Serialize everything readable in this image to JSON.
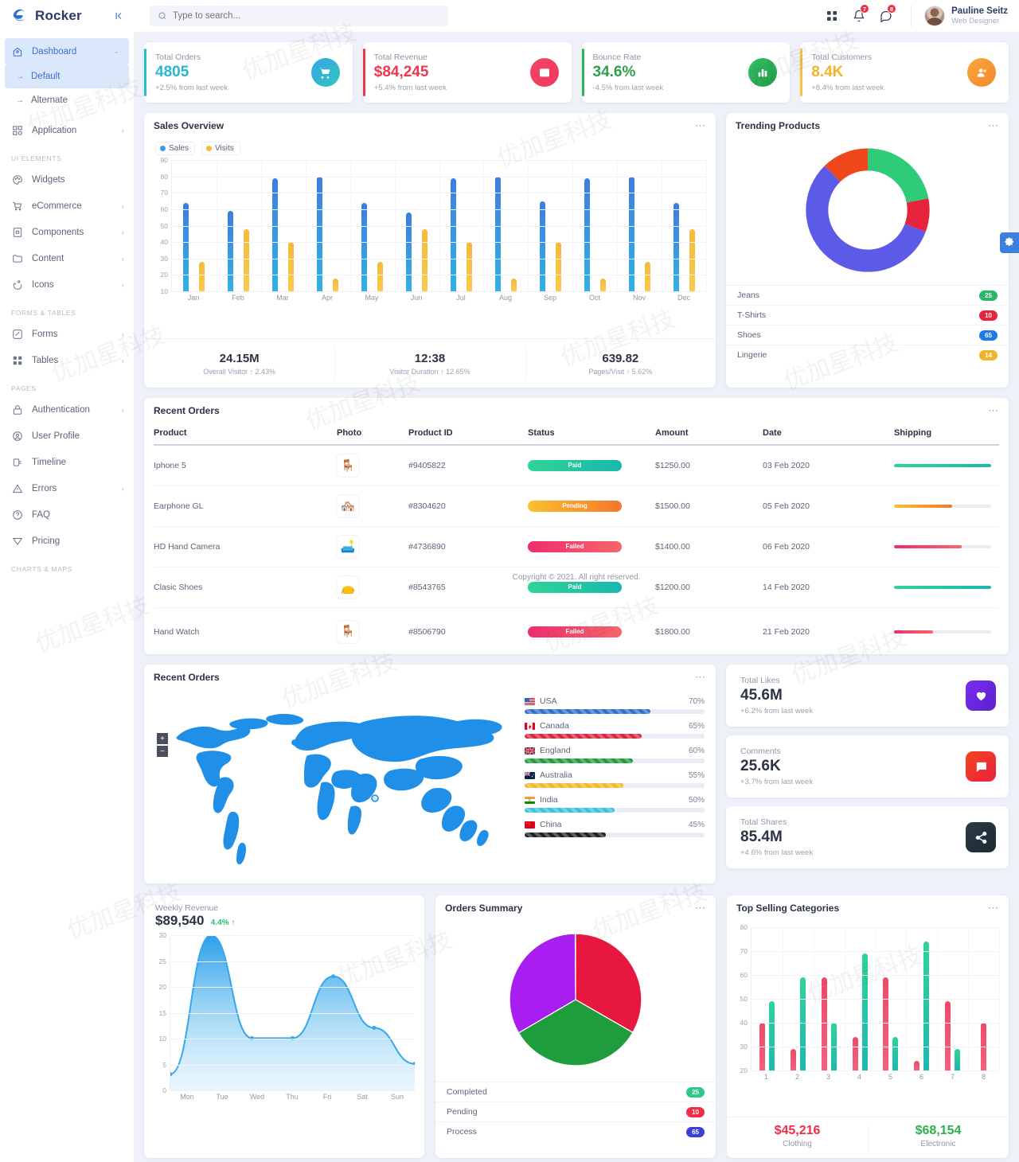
{
  "brand": {
    "name": "Rocker",
    "logo_icon": "wave-logo-icon",
    "collapse_icon": "collapse-left-icon"
  },
  "search": {
    "placeholder": "Type to search...",
    "value": "",
    "icon": "search-icon"
  },
  "header": {
    "grid_icon": "grid-apps-icon",
    "bell_icon": "bell-icon",
    "bell_badge": "7",
    "message_icon": "message-icon",
    "message_badge": "8",
    "user_name": "Pauline Seitz",
    "user_role": "Web Designer"
  },
  "sidebar": {
    "items": [
      {
        "label": "Dashboard",
        "icon": "home-icon",
        "chevron": "⌄",
        "active": true
      },
      {
        "label": "Default",
        "sub": true,
        "active": true
      },
      {
        "label": "Alternate",
        "sub": true,
        "active": false
      },
      {
        "label": "Application",
        "icon": "apps-grid-icon",
        "chevron": "‹"
      }
    ],
    "sections": [
      {
        "title": "UI ELEMENTS",
        "items": [
          {
            "label": "Widgets",
            "icon": "palette-icon",
            "chevron": ""
          },
          {
            "label": "eCommerce",
            "icon": "cart-icon",
            "chevron": "‹"
          },
          {
            "label": "Components",
            "icon": "component-icon",
            "chevron": "‹"
          },
          {
            "label": "Content",
            "icon": "folder-icon",
            "chevron": "‹"
          },
          {
            "label": "Icons",
            "icon": "hand-icon",
            "chevron": "‹"
          }
        ]
      },
      {
        "title": "FORMS & TABLES",
        "items": [
          {
            "label": "Forms",
            "icon": "edit-icon",
            "chevron": "‹"
          },
          {
            "label": "Tables",
            "icon": "table-icon",
            "chevron": "‹"
          }
        ]
      },
      {
        "title": "PAGES",
        "items": [
          {
            "label": "Authentication",
            "icon": "lock-icon",
            "chevron": "‹"
          },
          {
            "label": "User Profile",
            "icon": "user-circle-icon",
            "chevron": ""
          },
          {
            "label": "Timeline",
            "icon": "timeline-icon",
            "chevron": ""
          },
          {
            "label": "Errors",
            "icon": "warning-icon",
            "chevron": "‹"
          },
          {
            "label": "FAQ",
            "icon": "question-icon",
            "chevron": ""
          },
          {
            "label": "Pricing",
            "icon": "tag-icon",
            "chevron": ""
          }
        ]
      },
      {
        "title": "CHARTS & MAPS",
        "items": []
      }
    ]
  },
  "stats": [
    {
      "label": "Total Orders",
      "value": "4805",
      "sub": "+2.5% from last week",
      "color": "#28b7d3",
      "accent": "#2bc0c8",
      "icon": "cart-icon",
      "icon_from": "#3aa3e8",
      "icon_to": "#2ec7c0"
    },
    {
      "label": "Total Revenue",
      "value": "$84,245",
      "sub": "+5.4% from last week",
      "color": "#f0374f",
      "accent": "#ef3550",
      "icon": "wallet-icon",
      "icon_from": "#f2456a",
      "icon_to": "#ef3a5c"
    },
    {
      "label": "Bounce Rate",
      "value": "34.6%",
      "sub": "-4.5% from last week",
      "color": "#2f9e4f",
      "accent": "#2eb35b",
      "icon": "bar-chart-icon",
      "icon_from": "#36c06a",
      "icon_to": "#229a46"
    },
    {
      "label": "Total Customers",
      "value": "8.4K",
      "sub": "+8.4% from last week",
      "color": "#f0b429",
      "accent": "#f5c33b",
      "icon": "users-icon",
      "icon_from": "#f8a93c",
      "icon_to": "#f2872c"
    }
  ],
  "sales_overview": {
    "title": "Sales Overview",
    "legend": [
      {
        "name": "Sales",
        "color": "#3f9ae5"
      },
      {
        "name": "Visits",
        "color": "#f6b93b"
      }
    ],
    "footer": [
      {
        "value": "24.15M",
        "sub": "Overall Visitor ↑ 2.43%"
      },
      {
        "value": "12:38",
        "sub": "Visitor Duration ↑ 12.65%"
      },
      {
        "value": "639.82",
        "sub": "Pages/Visit ↑ 5.62%"
      }
    ]
  },
  "trending": {
    "title": "Trending Products",
    "items": [
      {
        "label": "Jeans",
        "badge": "25",
        "color": "#28b866"
      },
      {
        "label": "T-Shirts",
        "badge": "10",
        "color": "#e8243d"
      },
      {
        "label": "Shoes",
        "badge": "65",
        "color": "#1f7ae8"
      },
      {
        "label": "Lingerie",
        "badge": "14",
        "color": "#f0b429"
      }
    ]
  },
  "recent_orders": {
    "title": "Recent Orders",
    "columns": [
      "Product",
      "Photo",
      "Product ID",
      "Status",
      "Amount",
      "Date",
      "Shipping"
    ],
    "rows": [
      {
        "product": "Iphone 5",
        "photo": "🪑",
        "id": "#9405822",
        "status": "Paid",
        "status_from": "#2fd495",
        "status_to": "#19b7b0",
        "amount": "$1250.00",
        "date": "03 Feb 2020",
        "ship": 100,
        "ship_from": "#2fd495",
        "ship_to": "#19b7b0"
      },
      {
        "product": "Earphone GL",
        "photo": "🏘️",
        "id": "#8304620",
        "status": "Pending",
        "status_from": "#fbc02d",
        "status_to": "#f4762b",
        "amount": "$1500.00",
        "date": "05 Feb 2020",
        "ship": 60,
        "ship_from": "#fbc02d",
        "ship_to": "#f4762b"
      },
      {
        "product": "HD Hand Camera",
        "photo": "🛋️",
        "id": "#4736890",
        "status": "Failed",
        "status_from": "#ef2c6e",
        "status_to": "#f7666a",
        "amount": "$1400.00",
        "date": "06 Feb 2020",
        "ship": 70,
        "ship_from": "#ef2c6e",
        "ship_to": "#f7666a"
      },
      {
        "product": "Clasic Shoes",
        "photo": "👝",
        "id": "#8543765",
        "status": "Paid",
        "status_from": "#2fd495",
        "status_to": "#19b7b0",
        "amount": "$1200.00",
        "date": "14 Feb 2020",
        "ship": 100,
        "ship_from": "#2fd495",
        "ship_to": "#19b7b0"
      },
      {
        "product": "Hand Watch",
        "photo": "🪑",
        "id": "#8506790",
        "status": "Failed",
        "status_from": "#ef2c6e",
        "status_to": "#f7666a",
        "amount": "$1800.00",
        "date": "21 Feb 2020",
        "ship": 40,
        "ship_from": "#ef2c6e",
        "ship_to": "#f7666a"
      }
    ],
    "copyright": "Copyright © 2021. All right reserved."
  },
  "map_panel": {
    "title": "Recent Orders",
    "zoom_in": "+",
    "zoom_out": "−",
    "countries": [
      {
        "name": "USA",
        "pct": "70%",
        "value": 70,
        "color": "#2f6fd0"
      },
      {
        "name": "Canada",
        "pct": "65%",
        "value": 65,
        "color": "#d6293e"
      },
      {
        "name": "England",
        "pct": "60%",
        "value": 60,
        "color": "#1f9c3b"
      },
      {
        "name": "Australia",
        "pct": "55%",
        "value": 55,
        "color": "#f0b82a"
      },
      {
        "name": "India",
        "pct": "50%",
        "value": 50,
        "color": "#35c3e0"
      },
      {
        "name": "China",
        "pct": "45%",
        "value": 45,
        "color": "#222222"
      }
    ]
  },
  "social": [
    {
      "label": "Total Likes",
      "value": "45.6M",
      "sub": "+6.2% from last week",
      "icon": "heart-icon",
      "from": "#7b2ff0",
      "to": "#5b1fd0"
    },
    {
      "label": "Comments",
      "value": "25.6K",
      "sub": "+3.7% from last week",
      "icon": "comment-icon",
      "from": "#f7451f",
      "to": "#e8203f"
    },
    {
      "label": "Total Shares",
      "value": "85.4M",
      "sub": "+4.6% from last week",
      "icon": "share-icon",
      "from": "#2a3b45",
      "to": "#1c2b33"
    }
  ],
  "weekly_revenue": {
    "title": "Weekly Revenue",
    "value": "$89,540",
    "delta": "4.4% ↑"
  },
  "orders_summary": {
    "title": "Orders Summary",
    "items": [
      {
        "label": "Completed",
        "badge": "25",
        "color": "#2bc98a"
      },
      {
        "label": "Pending",
        "badge": "10",
        "color": "#ef2d4a"
      },
      {
        "label": "Process",
        "badge": "65",
        "color": "#3b3fd8"
      }
    ]
  },
  "top_selling": {
    "title": "Top Selling Categories",
    "footer": [
      {
        "value": "$45,216",
        "name": "Clothing",
        "color": "#ef2d4a"
      },
      {
        "value": "$68,154",
        "name": "Electronic",
        "color": "#2bb24c"
      }
    ]
  },
  "fab": {
    "icon": "gear-icon"
  },
  "chart_data": [
    {
      "type": "bar",
      "title": "Sales Overview",
      "categories": [
        "Jan",
        "Feb",
        "Mar",
        "Apr",
        "May",
        "Jun",
        "Jul",
        "Aug",
        "Sep",
        "Oct",
        "Nov",
        "Dec"
      ],
      "series": [
        {
          "name": "Sales",
          "color": "#3f9ae5",
          "values": [
            64,
            59,
            79,
            80,
            64,
            58,
            79,
            80,
            65,
            79,
            80,
            64
          ]
        },
        {
          "name": "Visits",
          "color": "#f6b93b",
          "values": [
            28,
            48,
            40,
            18,
            28,
            48,
            40,
            18,
            40,
            18,
            28,
            48
          ]
        }
      ],
      "ylim": [
        10,
        90
      ],
      "yticks": [
        10,
        20,
        30,
        40,
        50,
        60,
        70,
        80,
        90
      ],
      "xlabel": "",
      "ylabel": "",
      "grid": true,
      "legend": "top-left"
    },
    {
      "type": "pie",
      "title": "Trending Products",
      "labels": [
        "Jeans",
        "T-Shirts",
        "Shoes",
        "Lingerie"
      ],
      "values": [
        25,
        10,
        65,
        14
      ],
      "colors": [
        "#2ecc78",
        "#e8243d",
        "#5b5be8",
        "#f0461b"
      ],
      "donut": true
    },
    {
      "type": "area",
      "title": "Weekly Revenue",
      "x": [
        "Mon",
        "Tue",
        "Wed",
        "Thu",
        "Fri",
        "Sat",
        "Sun"
      ],
      "values": [
        3,
        30,
        10,
        10,
        22,
        12,
        5
      ],
      "ylim": [
        0,
        30
      ],
      "yticks": [
        0,
        5,
        10,
        15,
        20,
        25,
        30
      ],
      "color": "#35a8ec",
      "grid": true
    },
    {
      "type": "pie",
      "title": "Orders Summary",
      "labels": [
        "Completed",
        "Pending",
        "Process"
      ],
      "values": [
        33.3,
        33.3,
        33.3
      ],
      "colors": [
        "#e8173f",
        "#1f9c3b",
        "#a81ef0"
      ],
      "donut": false
    },
    {
      "type": "bar",
      "title": "Top Selling Categories",
      "categories": [
        "1",
        "2",
        "3",
        "4",
        "5",
        "6",
        "7",
        "8"
      ],
      "series": [
        {
          "name": "Clothing",
          "color": "#ef4a68",
          "values": [
            40,
            29,
            59,
            34,
            59,
            24,
            49,
            40
          ]
        },
        {
          "name": "Electronic",
          "color": "#2ec7a0",
          "values": [
            49,
            59,
            40,
            69,
            34,
            74,
            29,
            null
          ]
        }
      ],
      "ylim": [
        20,
        80
      ],
      "yticks": [
        20,
        30,
        40,
        50,
        60,
        70,
        80
      ],
      "grid": true
    }
  ]
}
